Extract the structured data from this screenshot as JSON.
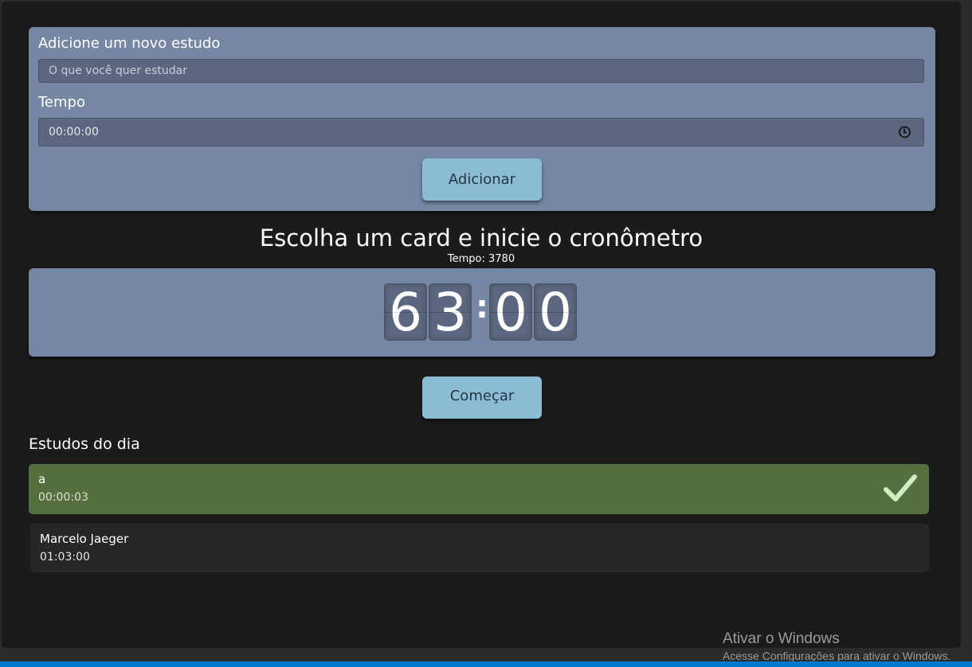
{
  "form": {
    "study_label": "Adicione um novo estudo",
    "study_placeholder": "O que você quer estudar",
    "time_label": "Tempo",
    "time_value": "00:00:00",
    "add_button": "Adicionar"
  },
  "timer": {
    "heading": "Escolha um card e inicie o cronômetro",
    "tempo_text": "Tempo: 3780",
    "digits": [
      "6",
      "3",
      "0",
      "0"
    ],
    "separator": ":",
    "start_button": "Começar"
  },
  "studies": {
    "title": "Estudos do dia",
    "items": [
      {
        "name": "a",
        "time": "00:00:03",
        "completed": true
      },
      {
        "name": "Marcelo Jaeger",
        "time": "01:03:00",
        "completed": false
      }
    ]
  },
  "watermark": {
    "title": "Ativar o Windows",
    "subtitle": "Acesse Configurações para ativar o Windows."
  },
  "colors": {
    "card": "#7587a2",
    "input": "#5b677e",
    "button": "#8abcd3",
    "completed": "#556f40",
    "background": "#1b1b1b",
    "statusbar": "#007acc"
  }
}
